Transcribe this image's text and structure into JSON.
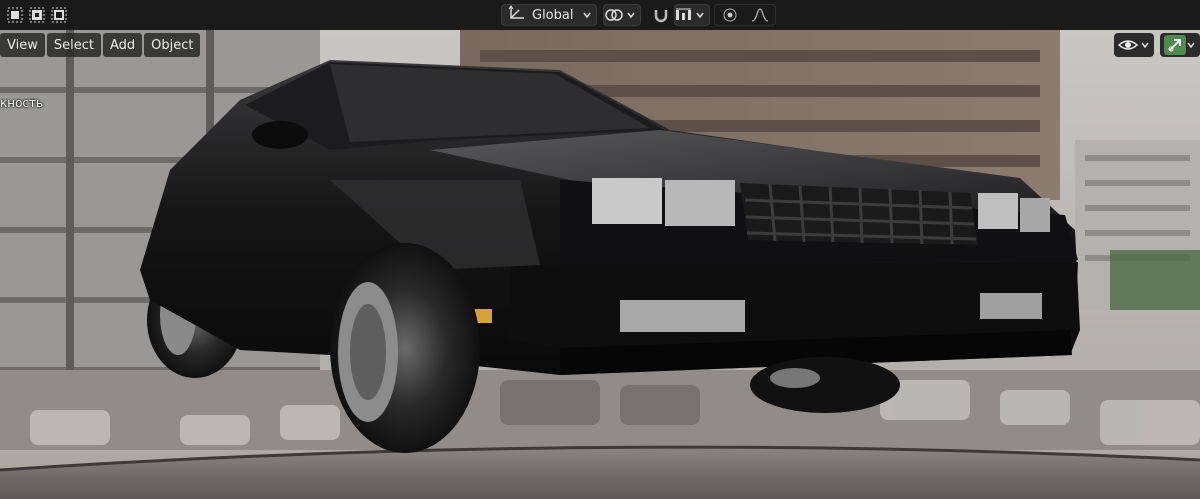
{
  "header": {
    "selection_modes": [
      "select-box-icon",
      "select-extend-icon",
      "select-subtract-icon"
    ],
    "orientation": {
      "label": "Global",
      "icon": "transform-orientation-icon"
    },
    "pivot_icon": "pivot-link-icon",
    "snap_icons": [
      "snap-magnet-icon",
      "snap-increment-icon"
    ],
    "proportional_icons": [
      "proportional-edit-icon",
      "falloff-curve-icon"
    ]
  },
  "viewport": {
    "menu": {
      "view": "View",
      "select": "Select",
      "add": "Add",
      "object": "Object"
    },
    "partial_label": "кность",
    "overlay_icons": [
      "visibility-eye-icon",
      "gizmo-arrow-icon"
    ]
  },
  "colors": {
    "header_bg": "#1a1a1a",
    "button_bg": "#2b2b2b",
    "gizmo_active": "#4f8a4f"
  }
}
